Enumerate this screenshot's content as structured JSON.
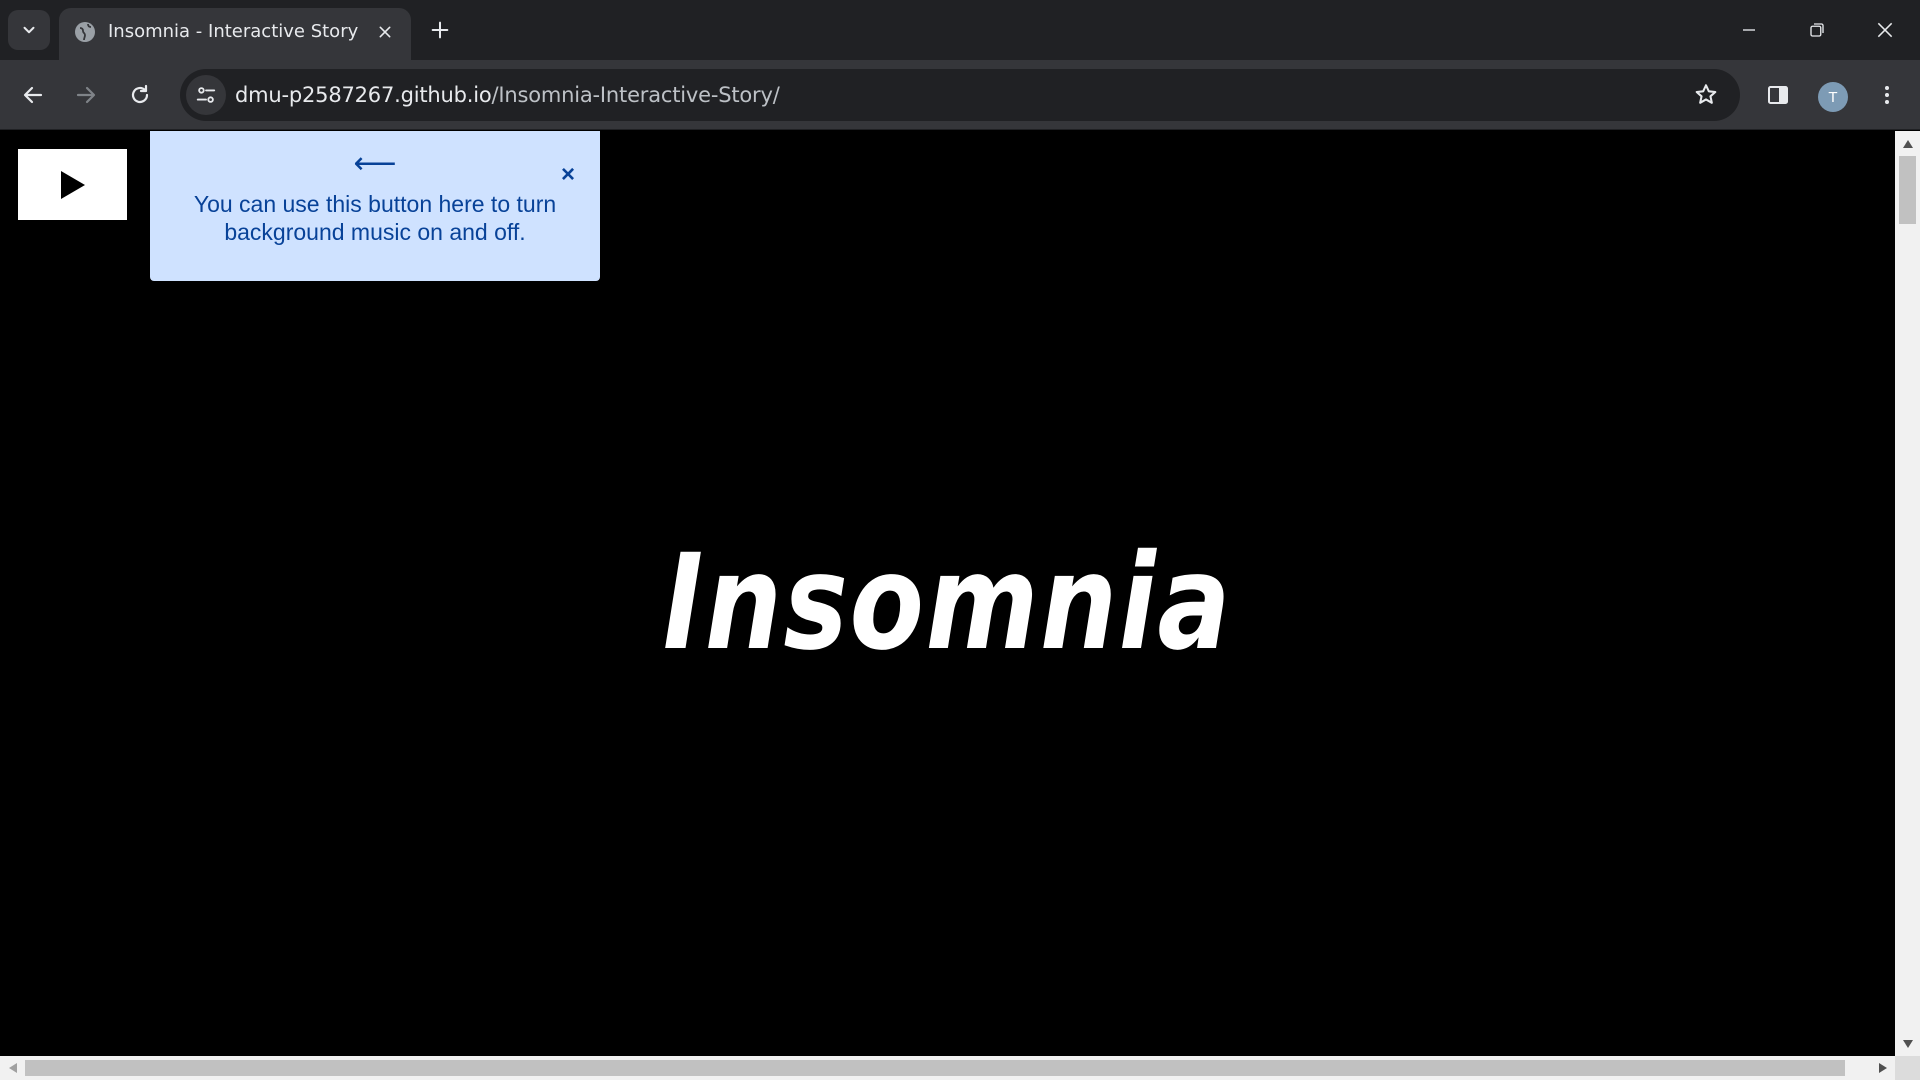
{
  "browser": {
    "tab": {
      "title": "Insomnia - Interactive Story"
    },
    "address_bar": {
      "host": "dmu-p2587267.github.io",
      "path": "/Insomnia-Interactive-Story/"
    },
    "profile_initial": "T",
    "icons": {
      "tab_list": "chevron-down-icon",
      "favicon": "globe-icon",
      "tab_close": "close-icon",
      "new_tab": "plus-icon",
      "minimize": "minimize-icon",
      "restore": "restore-icon",
      "close_window": "close-icon",
      "back": "arrow-left-icon",
      "forward": "arrow-right-icon",
      "reload": "reload-icon",
      "site_info": "tune-icon",
      "bookmark": "star-icon",
      "side_panel": "side-panel-icon",
      "menu": "kebab-menu-icon"
    }
  },
  "page": {
    "music_button": {
      "icon": "play-icon"
    },
    "tooltip": {
      "arrow": "⟵",
      "message": "You can use this button here to turn background music on and off.",
      "close_label": "×"
    },
    "title": "Insomnia"
  },
  "colors": {
    "page_background": "#000000",
    "tooltip_background": "#cfe2ff",
    "tooltip_text": "#084298",
    "title_text": "#ffffff"
  }
}
